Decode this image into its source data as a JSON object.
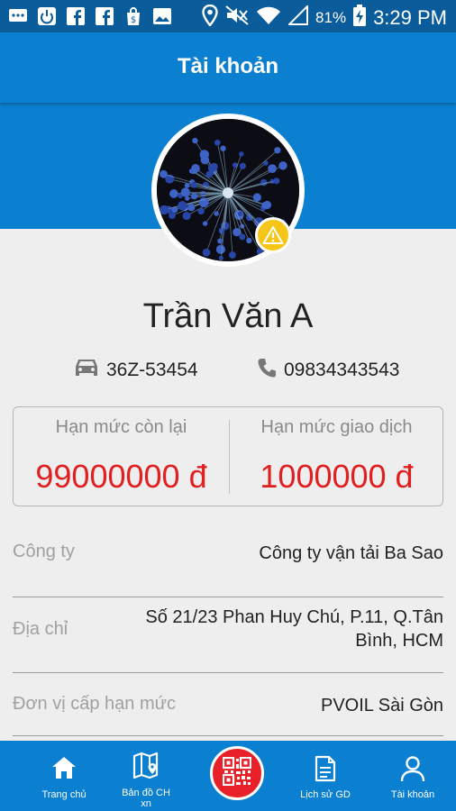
{
  "status_bar": {
    "battery_percent": "81%",
    "time": "3:29 PM",
    "left_icons": [
      "messages-icon",
      "power-icon",
      "facebook-icon",
      "facebook-icon",
      "shopping-bag-icon",
      "image-icon"
    ],
    "right_icons": [
      "location-icon",
      "mute-icon",
      "wifi-icon",
      "signal-icon",
      "battery-charging-icon"
    ]
  },
  "app_bar": {
    "title": "Tài khoản"
  },
  "profile": {
    "name": "Trần Văn A",
    "plate": "36Z-53454",
    "phone": "09834343543",
    "warning_icon": "warning-icon"
  },
  "limits": {
    "remaining_label": "Hạn mức còn lại",
    "remaining_value": "99000000 đ",
    "transaction_label": "Hạn mức giao dịch",
    "transaction_value": "1000000 đ"
  },
  "details": {
    "company_label": "Công ty",
    "company_value": "Công ty vận tải Ba Sao",
    "address_label": "Địa chỉ",
    "address_line1": "Số 21/23 Phan Huy Chú, P.11, Q.Tân",
    "address_line2": "Bình, HCM",
    "issuer_label": "Đơn vị cấp hạn mức",
    "issuer_value": "PVOIL Sài Gòn"
  },
  "bottom_nav": {
    "home": "Trang chủ",
    "map_line1": "Bản đồ CH",
    "map_line2": "xn",
    "history": "Lịch sử GD",
    "account": "Tài khoản"
  },
  "colors": {
    "primary": "#0b7fd0",
    "status_bar": "#0a5c9b",
    "accent_red": "#e02020",
    "warning": "#f5c518",
    "qr_button": "#e8202a"
  }
}
